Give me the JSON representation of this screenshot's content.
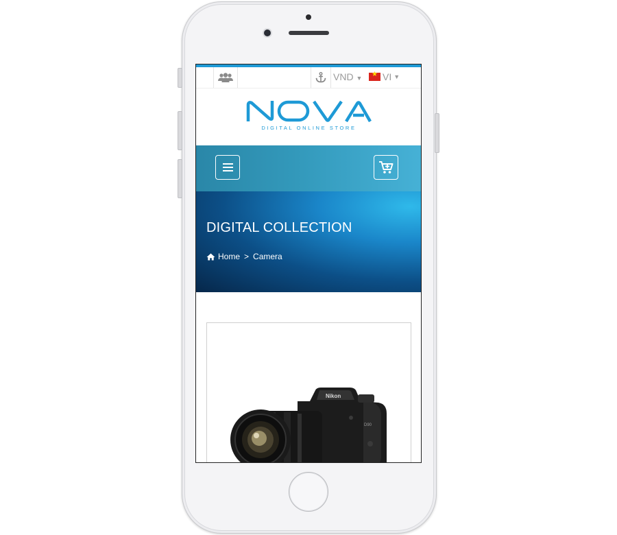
{
  "topbar": {
    "users_icon": "users-icon",
    "anchor_icon": "anchor-icon",
    "currency": "VND",
    "language": "VI",
    "flag_icon": "vietnam-flag-icon"
  },
  "logo": {
    "brand": "NOVA",
    "tagline": "DIGITAL ONLINE STORE"
  },
  "nav": {
    "menu_icon": "hamburger-icon",
    "cart_icon": "cart-add-icon"
  },
  "hero": {
    "title": "DIGITAL COLLECTION",
    "breadcrumb": {
      "home": "Home",
      "separator": ">",
      "current": "Camera"
    }
  },
  "product": {
    "image_icon": "camera-product-image"
  },
  "colors": {
    "accent": "#1e9ad6",
    "navbar": "#3399bb",
    "hero_dark": "#06274a"
  }
}
